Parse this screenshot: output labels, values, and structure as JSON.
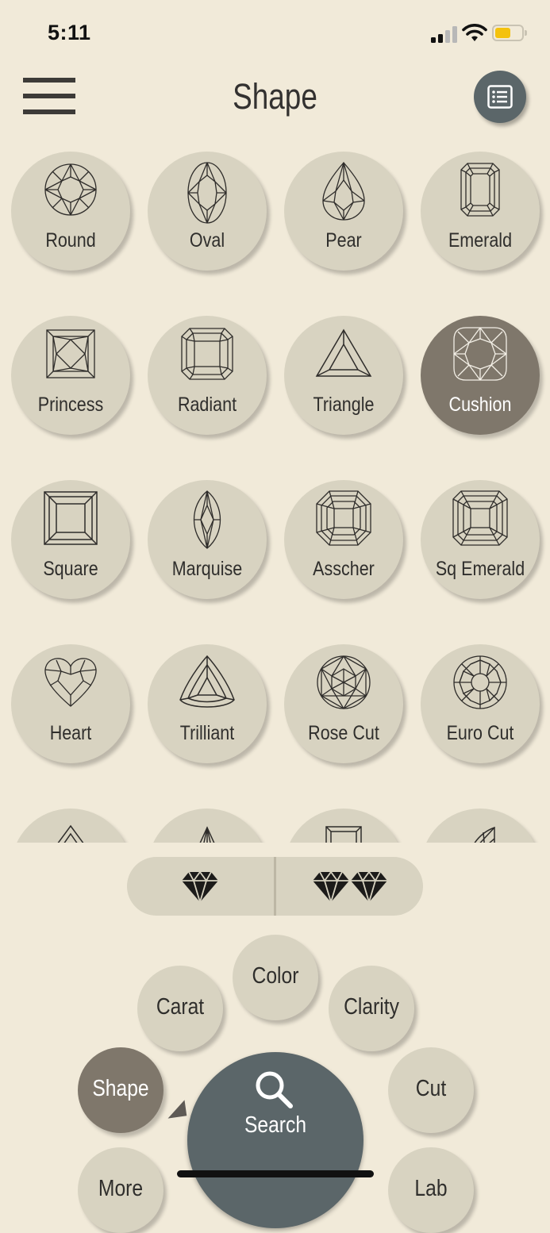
{
  "status_bar": {
    "time": "5:11"
  },
  "header": {
    "title": "Shape"
  },
  "shapes": [
    {
      "label": "Round",
      "icon": "round-diamond-icon",
      "selected": true
    },
    {
      "label": "Oval",
      "icon": "oval-diamond-icon",
      "selected": true
    },
    {
      "label": "Pear",
      "icon": "pear-diamond-icon",
      "selected": false
    },
    {
      "label": "Emerald",
      "icon": "emerald-diamond-icon",
      "selected": false
    },
    {
      "label": "Princess",
      "icon": "princess-diamond-icon",
      "selected": false
    },
    {
      "label": "Radiant",
      "icon": "radiant-diamond-icon",
      "selected": false
    },
    {
      "label": "Triangle",
      "icon": "triangle-diamond-icon",
      "selected": false
    },
    {
      "label": "Cushion",
      "icon": "cushion-diamond-icon",
      "selected": true
    },
    {
      "label": "Square",
      "icon": "square-diamond-icon",
      "selected": false
    },
    {
      "label": "Marquise",
      "icon": "marquise-diamond-icon",
      "selected": false
    },
    {
      "label": "Asscher",
      "icon": "asscher-diamond-icon",
      "selected": false
    },
    {
      "label": "Sq Emerald",
      "icon": "square-emerald-diamond-icon",
      "selected": false
    },
    {
      "label": "Heart",
      "icon": "heart-diamond-icon",
      "selected": false
    },
    {
      "label": "Trilliant",
      "icon": "trilliant-diamond-icon",
      "selected": false
    },
    {
      "label": "Rose Cut",
      "icon": "rose-cut-diamond-icon",
      "selected": false
    },
    {
      "label": "Euro Cut",
      "icon": "euro-cut-diamond-icon",
      "selected": false
    },
    {
      "label": "",
      "icon": "kite-diamond-icon",
      "selected": false
    },
    {
      "label": "",
      "icon": "shield-diamond-icon",
      "selected": false
    },
    {
      "label": "",
      "icon": "baguette-diamond-icon",
      "selected": false
    },
    {
      "label": "",
      "icon": "half-moon-diamond-icon",
      "selected": false
    }
  ],
  "diamond_toggle": [
    {
      "icon": "single-diamond-icon",
      "selected": false
    },
    {
      "icon": "pair-diamond-icon",
      "selected": false
    }
  ],
  "nav": {
    "carat": "Carat",
    "color": "Color",
    "clarity": "Clarity",
    "shape": "Shape",
    "cut": "Cut",
    "more": "More",
    "lab": "Lab",
    "search": "Search"
  },
  "colors": {
    "background": "#f1ead9",
    "tile": "#d8d3c1",
    "tile_selected": "#7f776b",
    "accent": "#5b6669"
  }
}
